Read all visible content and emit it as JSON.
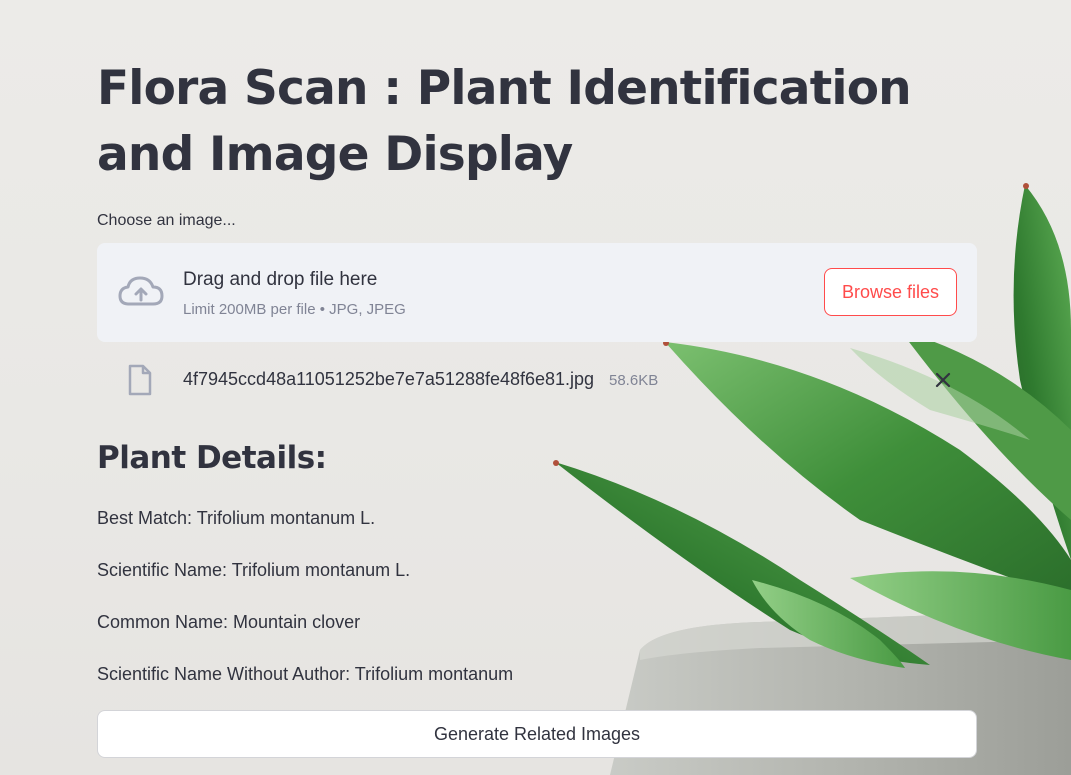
{
  "header": {
    "title": "Flora Scan : Plant Identification and Image Display"
  },
  "uploader": {
    "label": "Choose an image...",
    "drop_title": "Drag and drop file here",
    "limit_text": "Limit 200MB per file • JPG, JPEG",
    "browse_label": "Browse files",
    "icon": "cloud-upload-icon"
  },
  "uploaded_file": {
    "name": "4f7945ccd48a11051252be7e7a51288fe48f6e81.jpg",
    "size": "58.6KB",
    "icon": "file-icon",
    "remove_icon": "close-icon"
  },
  "details": {
    "heading": "Plant Details:",
    "best_match": "Best Match: Trifolium montanum L.",
    "scientific_name": "Scientific Name: Trifolium montanum L.",
    "common_name": "Common Name: Mountain clover",
    "scientific_no_author": "Scientific Name Without Author: Trifolium montanum"
  },
  "actions": {
    "generate_label": "Generate Related Images"
  },
  "colors": {
    "accent": "#ff4b4b",
    "text": "#31333f",
    "muted": "#808495",
    "dropzone_bg": "#f0f2f6",
    "leaf_green": "#3f8f3a"
  }
}
